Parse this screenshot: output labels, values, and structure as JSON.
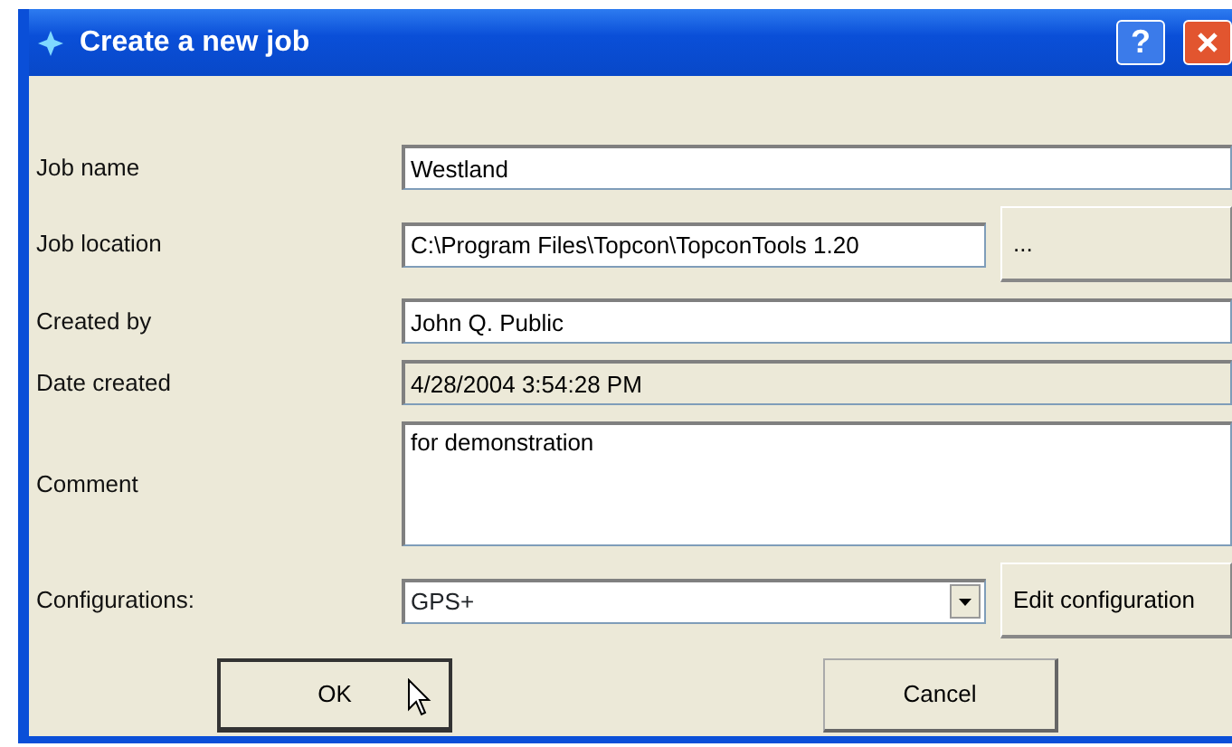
{
  "window": {
    "title": "Create a new job",
    "help_button": "?"
  },
  "fields": [
    {
      "label": "Job name",
      "kind": "text",
      "value": "Westland"
    },
    {
      "label": "Job location",
      "kind": "text",
      "value": "C:\\Program Files\\Topcon\\TopconTools 1.20",
      "button": "..."
    },
    {
      "label": "Created by",
      "kind": "text",
      "value": "John Q. Public"
    },
    {
      "label": "Date created",
      "kind": "readonly",
      "value": "4/28/2004 3:54:28 PM"
    },
    {
      "label": "Comment",
      "kind": "textarea",
      "value": "for demonstration"
    },
    {
      "label": "Configurations:",
      "kind": "select",
      "value": "GPS+",
      "button": "Edit configuration"
    }
  ],
  "buttons": [
    {
      "label": "OK",
      "default": true
    },
    {
      "label": "Cancel",
      "default": false
    }
  ]
}
